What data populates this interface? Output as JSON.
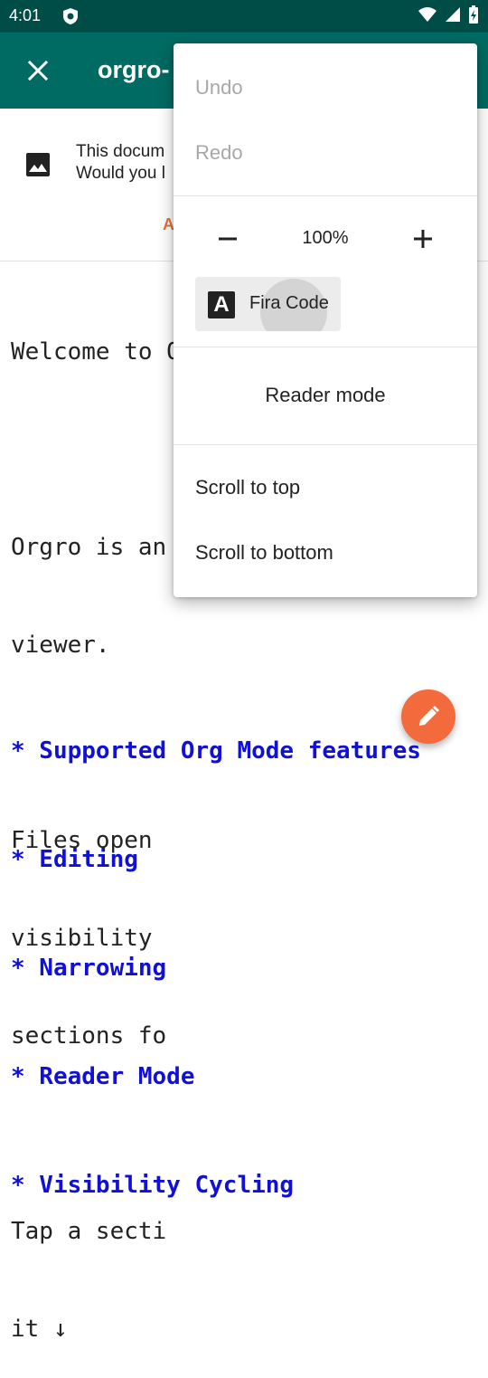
{
  "status_bar": {
    "time": "4:01"
  },
  "app_bar": {
    "title": "orgro-"
  },
  "banner": {
    "line1": "This docum",
    "line2": "Would you l",
    "action": "A"
  },
  "document": {
    "lines": [
      "Welcome to O",
      "",
      "Orgro is an",
      "viewer.",
      "",
      "Files open",
      "visibility",
      "sections fo",
      "",
      "Tap a secti",
      "it ↓"
    ],
    "headings": [
      "* Supported Org Mode features",
      "* Editing",
      "* Narrowing",
      "* Reader Mode",
      "* Visibility Cycling"
    ]
  },
  "menu": {
    "undo": "Undo",
    "redo": "Redo",
    "zoom_value": "100%",
    "font_name": "Fira Code",
    "font_icon_letter": "A",
    "reader_mode": "Reader mode",
    "scroll_top": "Scroll to top",
    "scroll_bottom": "Scroll to bottom"
  },
  "colors": {
    "status_bar": "#004d47",
    "app_bar": "#006b63",
    "fab": "#f36a3c",
    "heading": "#1010d8",
    "accent": "#e8703a"
  }
}
